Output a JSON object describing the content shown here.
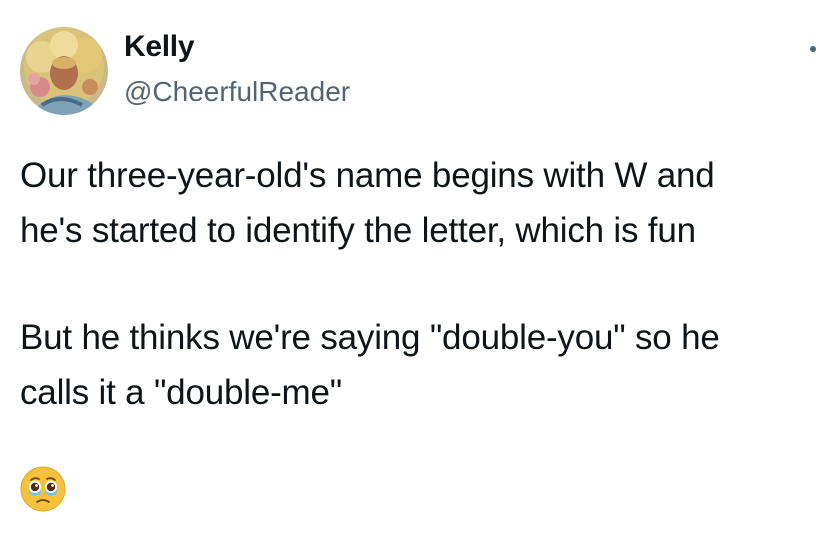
{
  "author": {
    "display_name": "Kelly",
    "handle": "@CheerfulReader",
    "avatar_icon": "user-avatar"
  },
  "menu": {
    "icon": "more-options-icon"
  },
  "tweet": {
    "paragraph_1_line_1": "Our three-year-old's name begins with W and",
    "paragraph_1_line_2": "he's started to identify the letter, which is fun",
    "paragraph_2_line_1": "But he thinks we're saying \"double-you\" so he",
    "paragraph_2_line_2": "calls it a \"double-me\"",
    "emoji": "face-holding-back-tears-emoji"
  },
  "colors": {
    "text_primary": "#0f1419",
    "text_secondary": "#536471",
    "emoji_yellow": "#f7c23b"
  }
}
